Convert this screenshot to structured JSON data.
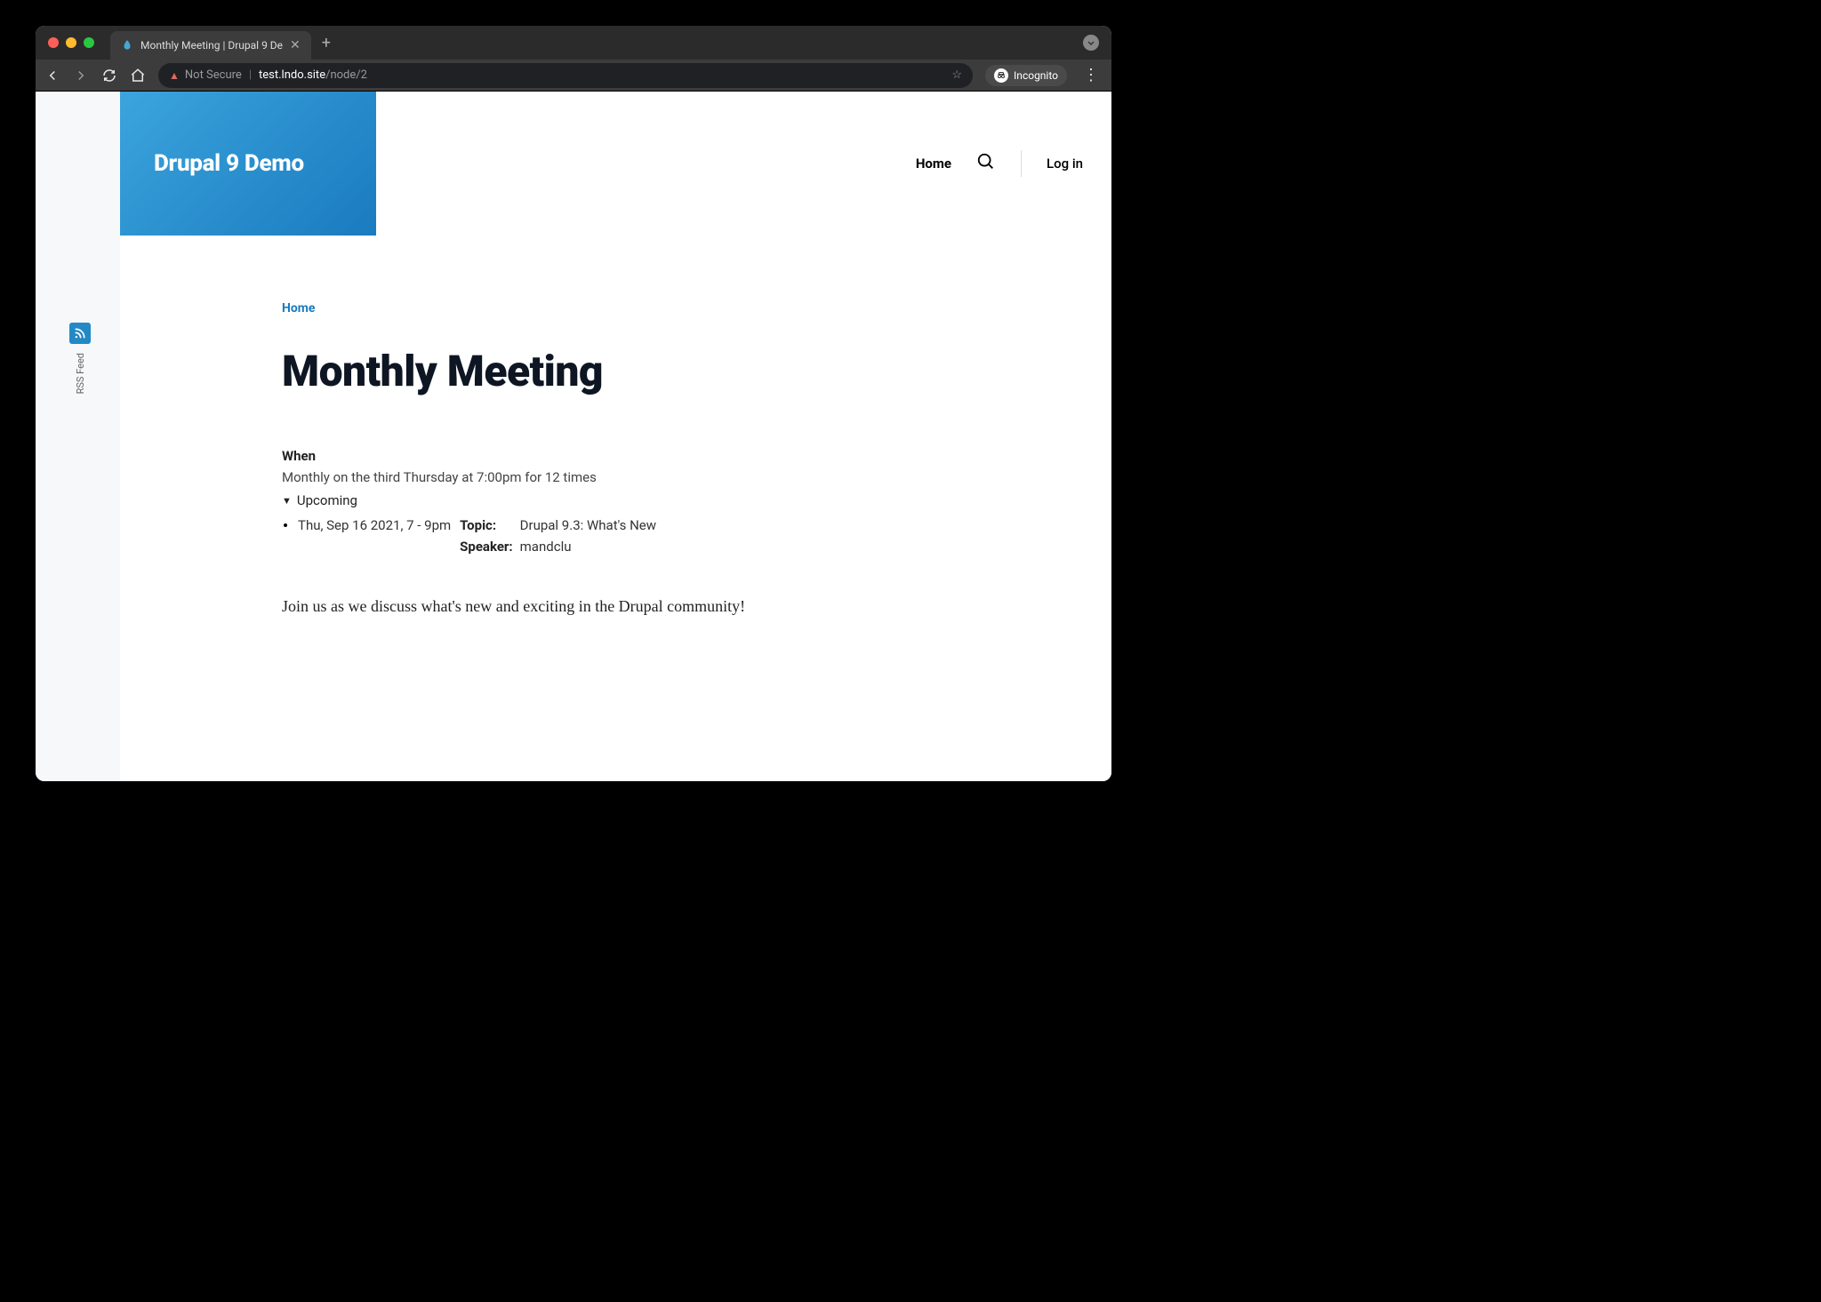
{
  "browser": {
    "tab_title": "Monthly Meeting | Drupal 9 De",
    "not_secure_label": "Not Secure",
    "url_host": "test.lndo.site",
    "url_path": "/node/2",
    "incognito_label": "Incognito"
  },
  "site": {
    "name": "Drupal 9 Demo"
  },
  "nav": {
    "home": "Home",
    "login": "Log in"
  },
  "sidebar": {
    "rss_label": "RSS Feed"
  },
  "breadcrumb": {
    "home": "Home"
  },
  "page": {
    "title": "Monthly Meeting",
    "when_label": "When",
    "when_text": "Monthly on the third Thursday at 7:00pm for 12 times",
    "upcoming_label": "Upcoming",
    "event": {
      "date": "Thu, Sep 16 2021, 7 - 9pm",
      "topic_label": "Topic:",
      "topic_value": "Drupal 9.3: What's New",
      "speaker_label": "Speaker:",
      "speaker_value": "mandclu"
    },
    "body": "Join us as we discuss what's new and exciting in the Drupal community!"
  }
}
